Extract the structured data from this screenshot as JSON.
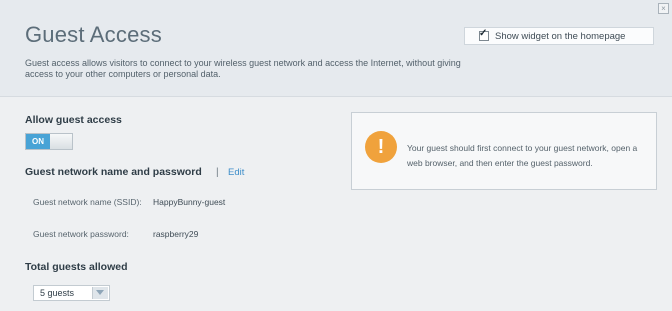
{
  "header": {
    "title": "Guest Access",
    "description": "Guest access allows visitors to connect to your wireless guest network and access the Internet, without giving access to your other computers or personal data.",
    "widget_toggle": {
      "label": "Show widget on the homepage",
      "checked": true
    },
    "close_icon": "close-icon"
  },
  "guest_access": {
    "label": "Allow guest access",
    "toggle_state": "ON"
  },
  "network": {
    "section_label": "Guest network name and password",
    "separator": "|",
    "edit_label": "Edit",
    "ssid_label": "Guest network name (SSID):",
    "ssid_value": "HappyBunny-guest",
    "password_label": "Guest network password:",
    "password_value": "raspberry29"
  },
  "notice": {
    "icon": "warning-icon",
    "icon_glyph": "!",
    "text": "Your guest should first connect to your guest network, open a web browser, and then enter the guest password."
  },
  "guests": {
    "label": "Total guests allowed",
    "selected": "5 guests"
  },
  "colors": {
    "accent": "#48a3d6",
    "warning": "#f0a23c",
    "link": "#3d8dc9"
  }
}
